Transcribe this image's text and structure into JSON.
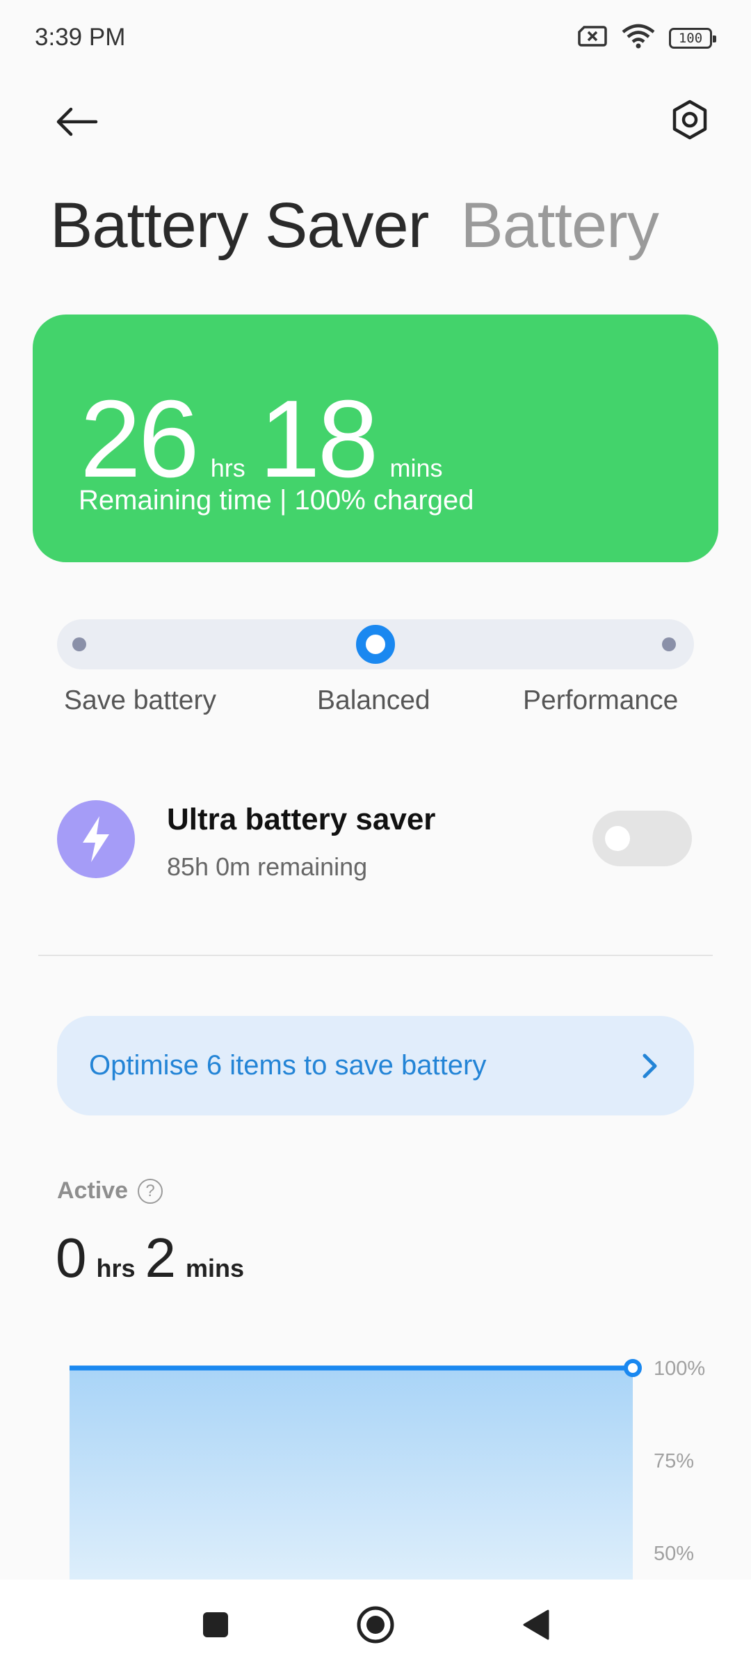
{
  "status_bar": {
    "time": "3:39 PM",
    "battery_level": "100",
    "icons": [
      "sim-blocked-icon",
      "wifi-icon",
      "battery-icon"
    ]
  },
  "header": {
    "back_icon": "arrow-left-icon",
    "settings_icon": "hexagon-gear-icon",
    "tabs": [
      {
        "label": "Battery Saver",
        "active": true
      },
      {
        "label": "Battery",
        "active": false
      }
    ]
  },
  "summary_card": {
    "hours": "26",
    "hours_unit": "hrs",
    "minutes": "18",
    "minutes_unit": "mins",
    "subtitle": "Remaining time | 100% charged",
    "color": "#43d36b"
  },
  "mode_selector": {
    "options": [
      "Save battery",
      "Balanced",
      "Performance"
    ],
    "selected": "Balanced",
    "accent": "#1a88f0"
  },
  "ultra_saver": {
    "title": "Ultra battery saver",
    "subtitle": "85h 0m remaining",
    "enabled": false,
    "icon": "lightning-icon",
    "icon_color": "#a59cf7"
  },
  "optimise_banner": {
    "text": "Optimise 6 items to save battery",
    "icon": "chevron-right-icon"
  },
  "active": {
    "label": "Active",
    "help_glyph": "?",
    "hours": "0",
    "hours_unit": "hrs",
    "minutes": "2",
    "minutes_unit": "mins"
  },
  "chart_data": {
    "type": "area",
    "y_tick_labels": [
      "100%",
      "75%",
      "50%"
    ],
    "series": [
      {
        "values": [
          100,
          100
        ]
      }
    ],
    "ylim": [
      50,
      100
    ],
    "grid": true,
    "color": "#1a88f0"
  },
  "nav": {
    "icons": [
      "recents-square-icon",
      "home-circle-icon",
      "back-triangle-icon"
    ]
  }
}
